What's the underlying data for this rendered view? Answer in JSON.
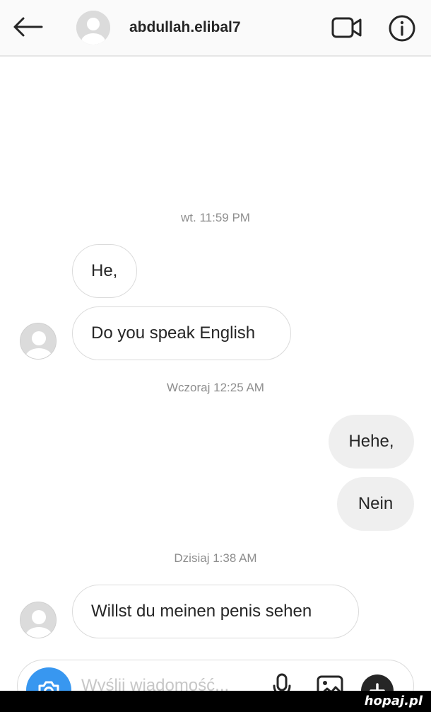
{
  "header": {
    "username": "abdullah.elibal7",
    "back_icon": "arrow-left-icon",
    "video_icon": "video-camera-icon",
    "info_icon": "info-icon"
  },
  "messages": [
    {
      "type": "timestamp",
      "text": "wt. 11:59 PM"
    },
    {
      "type": "incoming",
      "text": "He,"
    },
    {
      "type": "incoming",
      "text": "Do you speak English"
    },
    {
      "type": "timestamp",
      "text": "Wczoraj 12:25 AM"
    },
    {
      "type": "outgoing",
      "text": "Hehe,"
    },
    {
      "type": "outgoing",
      "text": "Nein"
    },
    {
      "type": "timestamp",
      "text": "Dzisiaj 1:38 AM"
    },
    {
      "type": "incoming",
      "text": "Willst du meinen penis sehen"
    }
  ],
  "composer": {
    "placeholder": "Wyślij wiadomość...",
    "camera_icon": "camera-icon",
    "mic_icon": "microphone-icon",
    "gallery_icon": "image-icon",
    "plus_icon": "plus-icon"
  },
  "watermark": "hopaj.pl",
  "colors": {
    "accent": "#3897f0",
    "outgoing_bubble": "#efefef",
    "incoming_border": "#dbdbdb",
    "timestamp": "#8e8e8e"
  }
}
